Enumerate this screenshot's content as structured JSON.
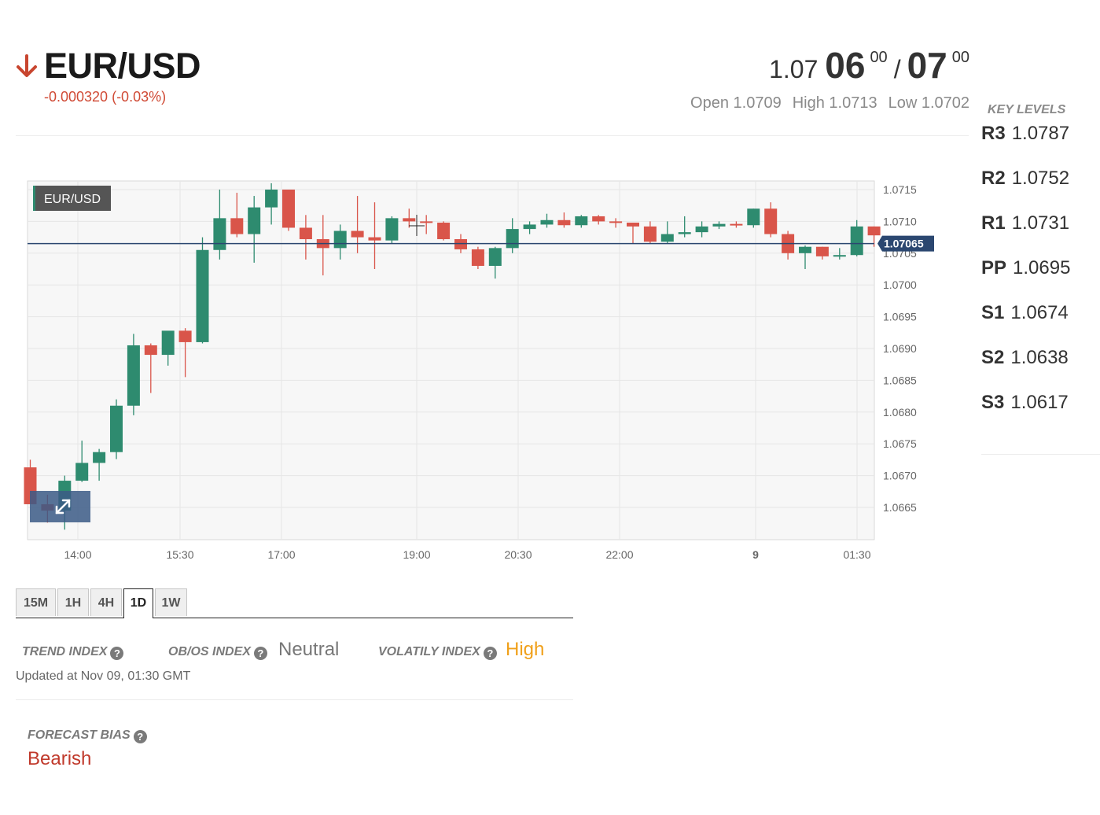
{
  "header": {
    "pair": "EUR/USD",
    "change": "-0.000320 (-0.03%)",
    "direction_icon": "arrow-down-icon",
    "price": {
      "bid_prefix": "1.07",
      "bid_big": "06",
      "bid_sup": "00",
      "separator": "/",
      "ask_big": "07",
      "ask_sup": "00"
    },
    "ohl": {
      "open": "Open 1.0709",
      "high": "High 1.0713",
      "low": "Low 1.0702"
    }
  },
  "key_levels": {
    "title": "KEY LEVELS",
    "levels": [
      {
        "name": "R3",
        "value": "1.0787"
      },
      {
        "name": "R2",
        "value": "1.0752"
      },
      {
        "name": "R1",
        "value": "1.0731"
      },
      {
        "name": "PP",
        "value": "1.0695"
      },
      {
        "name": "S1",
        "value": "1.0674"
      },
      {
        "name": "S2",
        "value": "1.0638"
      },
      {
        "name": "S3",
        "value": "1.0617"
      }
    ]
  },
  "chart": {
    "symbol_badge": "EUR/USD",
    "current_price_label": "1.07065",
    "expand_icon": "expand-icon"
  },
  "chart_data": {
    "type": "candlestick",
    "current_price": 1.07065,
    "ylim": [
      1.066,
      1.0718
    ],
    "y_ticks": [
      "1.0715",
      "1.0710",
      "1.0705",
      "1.0700",
      "1.0695",
      "1.0690",
      "1.0685",
      "1.0680",
      "1.0675",
      "1.0670",
      "1.0665"
    ],
    "x_ticks": [
      "14:00",
      "15:30",
      "17:00",
      "19:00",
      "20:30",
      "22:00",
      "9",
      "01:30"
    ],
    "candles": [
      {
        "o": 1.06713,
        "h": 1.06725,
        "l": 1.06655,
        "c": 1.06655
      },
      {
        "o": 1.06655,
        "h": 1.0667,
        "l": 1.06626,
        "c": 1.06645
      },
      {
        "o": 1.06645,
        "h": 1.067,
        "l": 1.06615,
        "c": 1.06692
      },
      {
        "o": 1.06692,
        "h": 1.06755,
        "l": 1.0669,
        "c": 1.0672
      },
      {
        "o": 1.0672,
        "h": 1.06742,
        "l": 1.06692,
        "c": 1.06737
      },
      {
        "o": 1.06737,
        "h": 1.0682,
        "l": 1.06726,
        "c": 1.0681
      },
      {
        "o": 1.0681,
        "h": 1.06923,
        "l": 1.06795,
        "c": 1.06905
      },
      {
        "o": 1.06905,
        "h": 1.06908,
        "l": 1.0683,
        "c": 1.0689
      },
      {
        "o": 1.0689,
        "h": 1.06925,
        "l": 1.06873,
        "c": 1.06928
      },
      {
        "o": 1.06928,
        "h": 1.06932,
        "l": 1.06855,
        "c": 1.0691
      },
      {
        "o": 1.0691,
        "h": 1.07075,
        "l": 1.06908,
        "c": 1.07055
      },
      {
        "o": 1.07055,
        "h": 1.0715,
        "l": 1.0704,
        "c": 1.07105
      },
      {
        "o": 1.07105,
        "h": 1.07145,
        "l": 1.07075,
        "c": 1.0708
      },
      {
        "o": 1.0708,
        "h": 1.0714,
        "l": 1.07035,
        "c": 1.07122
      },
      {
        "o": 1.07122,
        "h": 1.0716,
        "l": 1.07095,
        "c": 1.0715
      },
      {
        "o": 1.0715,
        "h": 1.0715,
        "l": 1.07085,
        "c": 1.0709
      },
      {
        "o": 1.0709,
        "h": 1.0711,
        "l": 1.0704,
        "c": 1.07072
      },
      {
        "o": 1.07072,
        "h": 1.0711,
        "l": 1.07015,
        "c": 1.07058
      },
      {
        "o": 1.07058,
        "h": 1.07095,
        "l": 1.0704,
        "c": 1.07085
      },
      {
        "o": 1.07085,
        "h": 1.0714,
        "l": 1.0705,
        "c": 1.07075
      },
      {
        "o": 1.07075,
        "h": 1.0713,
        "l": 1.07025,
        "c": 1.0707
      },
      {
        "o": 1.0707,
        "h": 1.07108,
        "l": 1.07065,
        "c": 1.07105
      },
      {
        "o": 1.07105,
        "h": 1.0712,
        "l": 1.0709,
        "c": 1.071
      },
      {
        "o": 1.071,
        "h": 1.0711,
        "l": 1.0708,
        "c": 1.07098
      },
      {
        "o": 1.07098,
        "h": 1.071,
        "l": 1.0707,
        "c": 1.07072
      },
      {
        "o": 1.07072,
        "h": 1.0708,
        "l": 1.0705,
        "c": 1.07056
      },
      {
        "o": 1.07056,
        "h": 1.0706,
        "l": 1.07025,
        "c": 1.0703
      },
      {
        "o": 1.0703,
        "h": 1.0706,
        "l": 1.0701,
        "c": 1.07058
      },
      {
        "o": 1.07058,
        "h": 1.07105,
        "l": 1.0705,
        "c": 1.07088
      },
      {
        "o": 1.07088,
        "h": 1.071,
        "l": 1.0708,
        "c": 1.07095
      },
      {
        "o": 1.07095,
        "h": 1.07112,
        "l": 1.0709,
        "c": 1.07102
      },
      {
        "o": 1.07102,
        "h": 1.07114,
        "l": 1.0709,
        "c": 1.07094
      },
      {
        "o": 1.07094,
        "h": 1.0711,
        "l": 1.0709,
        "c": 1.07108
      },
      {
        "o": 1.07108,
        "h": 1.0711,
        "l": 1.07095,
        "c": 1.071
      },
      {
        "o": 1.071,
        "h": 1.07105,
        "l": 1.0709,
        "c": 1.07098
      },
      {
        "o": 1.07098,
        "h": 1.07098,
        "l": 1.07065,
        "c": 1.07092
      },
      {
        "o": 1.07092,
        "h": 1.071,
        "l": 1.07065,
        "c": 1.07068
      },
      {
        "o": 1.07068,
        "h": 1.071,
        "l": 1.07065,
        "c": 1.0708
      },
      {
        "o": 1.0708,
        "h": 1.07108,
        "l": 1.07075,
        "c": 1.07083
      },
      {
        "o": 1.07083,
        "h": 1.071,
        "l": 1.07075,
        "c": 1.07092
      },
      {
        "o": 1.07092,
        "h": 1.071,
        "l": 1.07088,
        "c": 1.07096
      },
      {
        "o": 1.07096,
        "h": 1.071,
        "l": 1.0709,
        "c": 1.07094
      },
      {
        "o": 1.07094,
        "h": 1.0712,
        "l": 1.0709,
        "c": 1.0712
      },
      {
        "o": 1.0712,
        "h": 1.0713,
        "l": 1.07075,
        "c": 1.0708
      },
      {
        "o": 1.0708,
        "h": 1.07085,
        "l": 1.0704,
        "c": 1.0705
      },
      {
        "o": 1.0705,
        "h": 1.07062,
        "l": 1.07025,
        "c": 1.0706
      },
      {
        "o": 1.0706,
        "h": 1.0706,
        "l": 1.0704,
        "c": 1.07045
      },
      {
        "o": 1.07045,
        "h": 1.07058,
        "l": 1.0704,
        "c": 1.07047
      },
      {
        "o": 1.07047,
        "h": 1.07102,
        "l": 1.07045,
        "c": 1.07092
      },
      {
        "o": 1.07092,
        "h": 1.07092,
        "l": 1.0706,
        "c": 1.07078
      }
    ]
  },
  "timeframes": {
    "tabs": [
      "15M",
      "1H",
      "4H",
      "1D",
      "1W"
    ],
    "active": "1D"
  },
  "indexes": {
    "trend_label": "TREND INDEX",
    "obos_label": "OB/OS INDEX",
    "obos_value": "Neutral",
    "volatility_label": "VOLATILY INDEX",
    "volatility_value": "High",
    "updated": "Updated at Nov 09, 01:30 GMT"
  },
  "forecast": {
    "label": "FORECAST BIAS",
    "value": "Bearish"
  },
  "colors": {
    "up": "#2e8b6f",
    "down": "#d9554a",
    "bearish": "#c0392b",
    "high": "#f0a01a",
    "neutral": "#777777",
    "price_line": "#2b4770"
  }
}
